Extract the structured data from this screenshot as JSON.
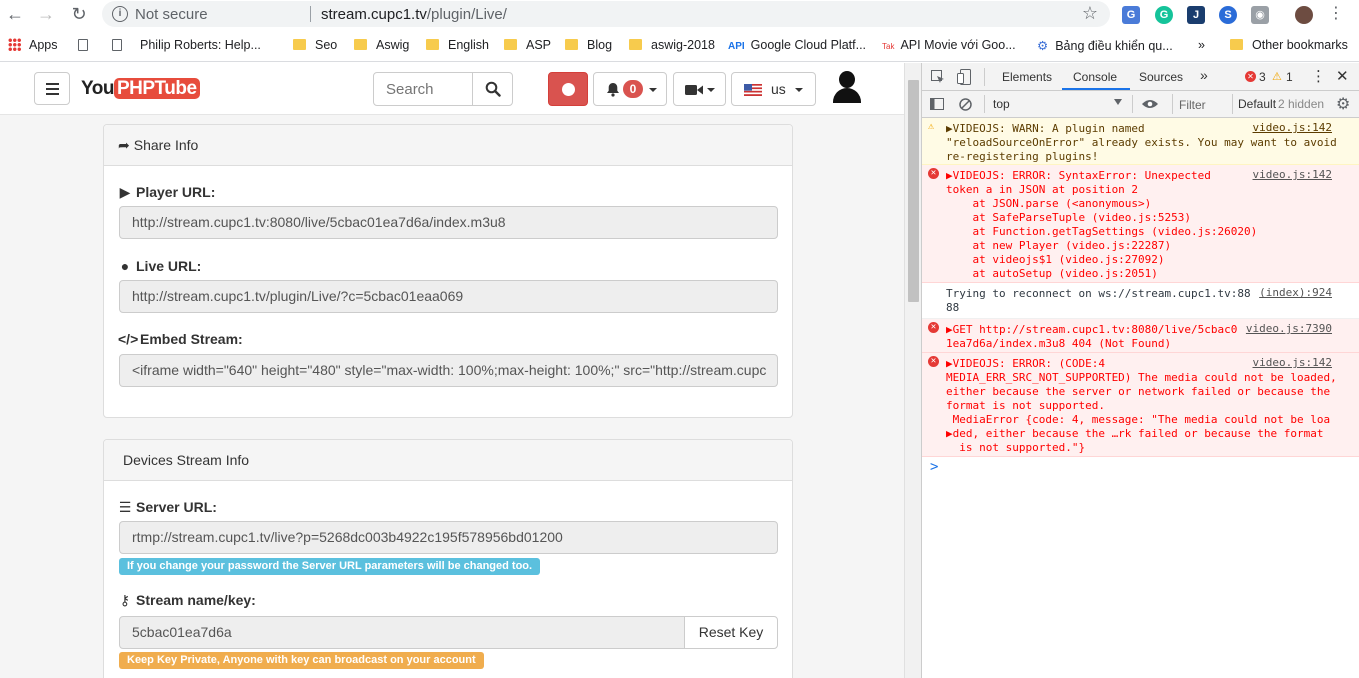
{
  "browser": {
    "not_secure": "Not secure",
    "url_host": "stream.cupc1.tv",
    "url_path": "/plugin/Live/",
    "bookmarks": [
      "Apps",
      "Philip Roberts: Help...",
      "Seo",
      "Aswig",
      "English",
      "ASP",
      "Blog",
      "aswig-2018",
      "Google Cloud Platf...",
      "API Movie với Goo...",
      "Bảng điều khiển qu..."
    ],
    "more_bookmarks": "»",
    "other_bookmarks": "Other bookmarks",
    "api_tag": "API",
    "tak_tag": "Tak"
  },
  "site": {
    "logo_you": "You",
    "logo_php": "PHPTube",
    "search_placeholder": "Search",
    "notif_count": "0",
    "lang": "us"
  },
  "share": {
    "title": "Share Info",
    "player_label": "Player URL:",
    "player_url": "http://stream.cupc1.tv:8080/live/5cbac01ea7d6a/index.m3u8",
    "live_label": "Live URL:",
    "live_url": "http://stream.cupc1.tv/plugin/Live/?c=5cbac01eaa069",
    "embed_label": "Embed Stream:",
    "embed_code": "<iframe width=\"640\" height=\"480\" style=\"max-width: 100%;max-height: 100%;\" src=\"http://stream.cupc"
  },
  "devices": {
    "title": "Devices Stream Info",
    "server_label": "Server URL:",
    "server_url": "rtmp://stream.cupc1.tv/live?p=5268dc003b4922c195f578956bd01200",
    "server_help": "If you change your password the Server URL parameters will be changed too.",
    "key_label": "Stream name/key:",
    "key_value": "5cbac01ea7d6a",
    "reset_key": "Reset Key",
    "key_help": "Keep Key Private, Anyone with key can broadcast on your account"
  },
  "devtools": {
    "tabs": [
      "Elements",
      "Console",
      "Sources"
    ],
    "more_tabs": "»",
    "error_count": "3",
    "warn_count": "1",
    "context": "top",
    "filter": "Filter",
    "levels": "Default",
    "hidden": "2 hidden",
    "messages": [
      {
        "type": "warn",
        "text": "▶VIDEOJS: WARN: A plugin named\n\"reloadSourceOnError\" already exists. You may want to avoid\nre-registering plugins!",
        "source": "video.js:142"
      },
      {
        "type": "error",
        "text": "▶VIDEOJS: ERROR: SyntaxError: Unexpected\ntoken a in JSON at position 2\n    at JSON.parse (<anonymous>)\n    at SafeParseTuple (video.js:5253)\n    at Function.getTagSettings (video.js:26020)\n    at new Player (video.js:22287)\n    at videojs$1 (video.js:27092)\n    at autoSetup (video.js:2051)",
        "source": "video.js:142"
      },
      {
        "type": "log",
        "text": "Trying to reconnect on ws://stream.cupc1.tv:88\n88",
        "source": "(index):924"
      },
      {
        "type": "error",
        "text": "▶GET http://stream.cupc1.tv:8080/live/5cbac0\n1ea7d6a/index.m3u8 404 (Not Found)",
        "source": "video.js:7390"
      },
      {
        "type": "error",
        "text": "▶VIDEOJS: ERROR: (CODE:4\nMEDIA_ERR_SRC_NOT_SUPPORTED) The media could not be loaded,\neither because the server or network failed or because the\nformat is not supported.\n MediaError {code: 4, message: \"The media could not be loa\n▶ded, either because the …rk failed or because the format\n  is not supported.\"}",
        "source": "video.js:142"
      }
    ],
    "prompt": ">"
  }
}
